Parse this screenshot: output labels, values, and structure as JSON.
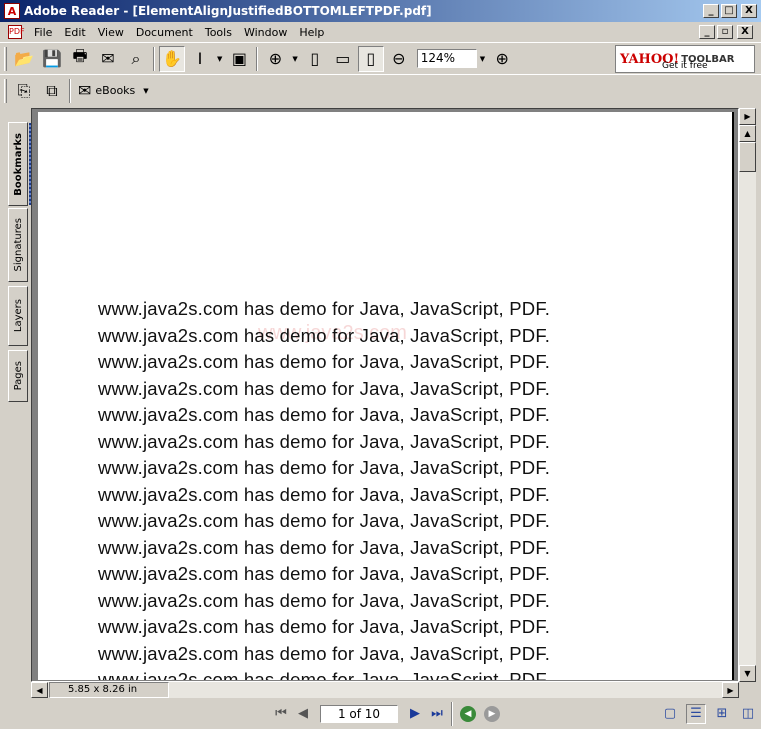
{
  "window": {
    "title": "Adobe Reader - [ElementAlignJustifiedBOTTOMLEFTPDF.pdf]",
    "minimize": "_",
    "maximize": "□",
    "close": "X",
    "doc_minimize": "_",
    "doc_restore": "▫",
    "doc_close": "X"
  },
  "menu": {
    "items": [
      "File",
      "Edit",
      "View",
      "Document",
      "Tools",
      "Window",
      "Help"
    ]
  },
  "toolbar": {
    "zoom_value": "124%",
    "ebooks_label": "eBooks",
    "yahoo_logo": "YAHOO!",
    "yahoo_toolbar": "TOOLBAR",
    "yahoo_sub": "Get it free"
  },
  "nav_tabs": [
    "Bookmarks",
    "Signatures",
    "Layers",
    "Pages"
  ],
  "document": {
    "watermark": "www.java2s.com",
    "lines": [
      "www.java2s.com has demo for Java, JavaScript, PDF.",
      "www.java2s.com has demo for Java, JavaScript, PDF.",
      "www.java2s.com has demo for Java, JavaScript, PDF.",
      "www.java2s.com has demo for Java, JavaScript, PDF.",
      "www.java2s.com has demo for Java, JavaScript, PDF.",
      "www.java2s.com has demo for Java, JavaScript, PDF.",
      "www.java2s.com has demo for Java, JavaScript, PDF.",
      "www.java2s.com has demo for Java, JavaScript, PDF.",
      "www.java2s.com has demo for Java, JavaScript, PDF.",
      "www.java2s.com has demo for Java, JavaScript, PDF.",
      "www.java2s.com has demo for Java, JavaScript, PDF.",
      "www.java2s.com has demo for Java, JavaScript, PDF.",
      "www.java2s.com has demo for Java, JavaScript, PDF.",
      "www.java2s.com has demo for Java, JavaScript, PDF.",
      "www.java2s.com has demo for Java, JavaScript, PDF."
    ]
  },
  "status": {
    "page_size": "5.85 x 8.26 in",
    "page_indicator": "1 of 10"
  },
  "colors": {
    "titlebar_start": "#0a246a",
    "titlebar_end": "#a6caf0",
    "chrome": "#d4d0c8",
    "watermark": "#f0b8b8"
  }
}
